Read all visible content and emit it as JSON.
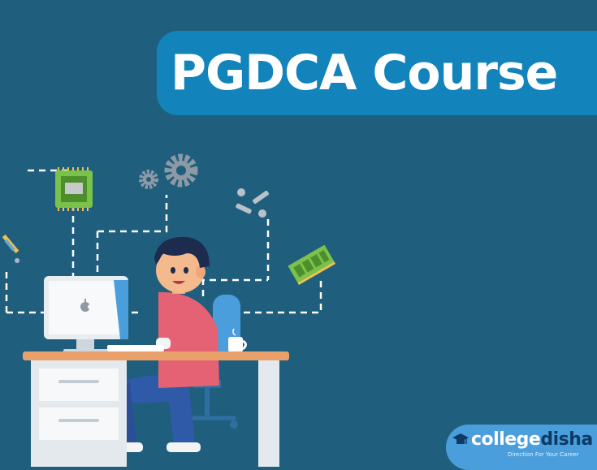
{
  "title": "PGDCA Course",
  "brand": {
    "prefix": "college",
    "accent": "disha",
    "tagline": "Direction For Your Career"
  },
  "icons": [
    "screwdriver-icon",
    "cpu-chip-icon",
    "gear-icon",
    "screw-icon",
    "ram-module-icon",
    "apple-logo-icon",
    "graduation-cap-icon"
  ],
  "colors": {
    "background": "#1f5f7d",
    "banner": "#1383bb",
    "logo_pill": "#4a9edb",
    "logo_accent": "#0e3a66"
  }
}
